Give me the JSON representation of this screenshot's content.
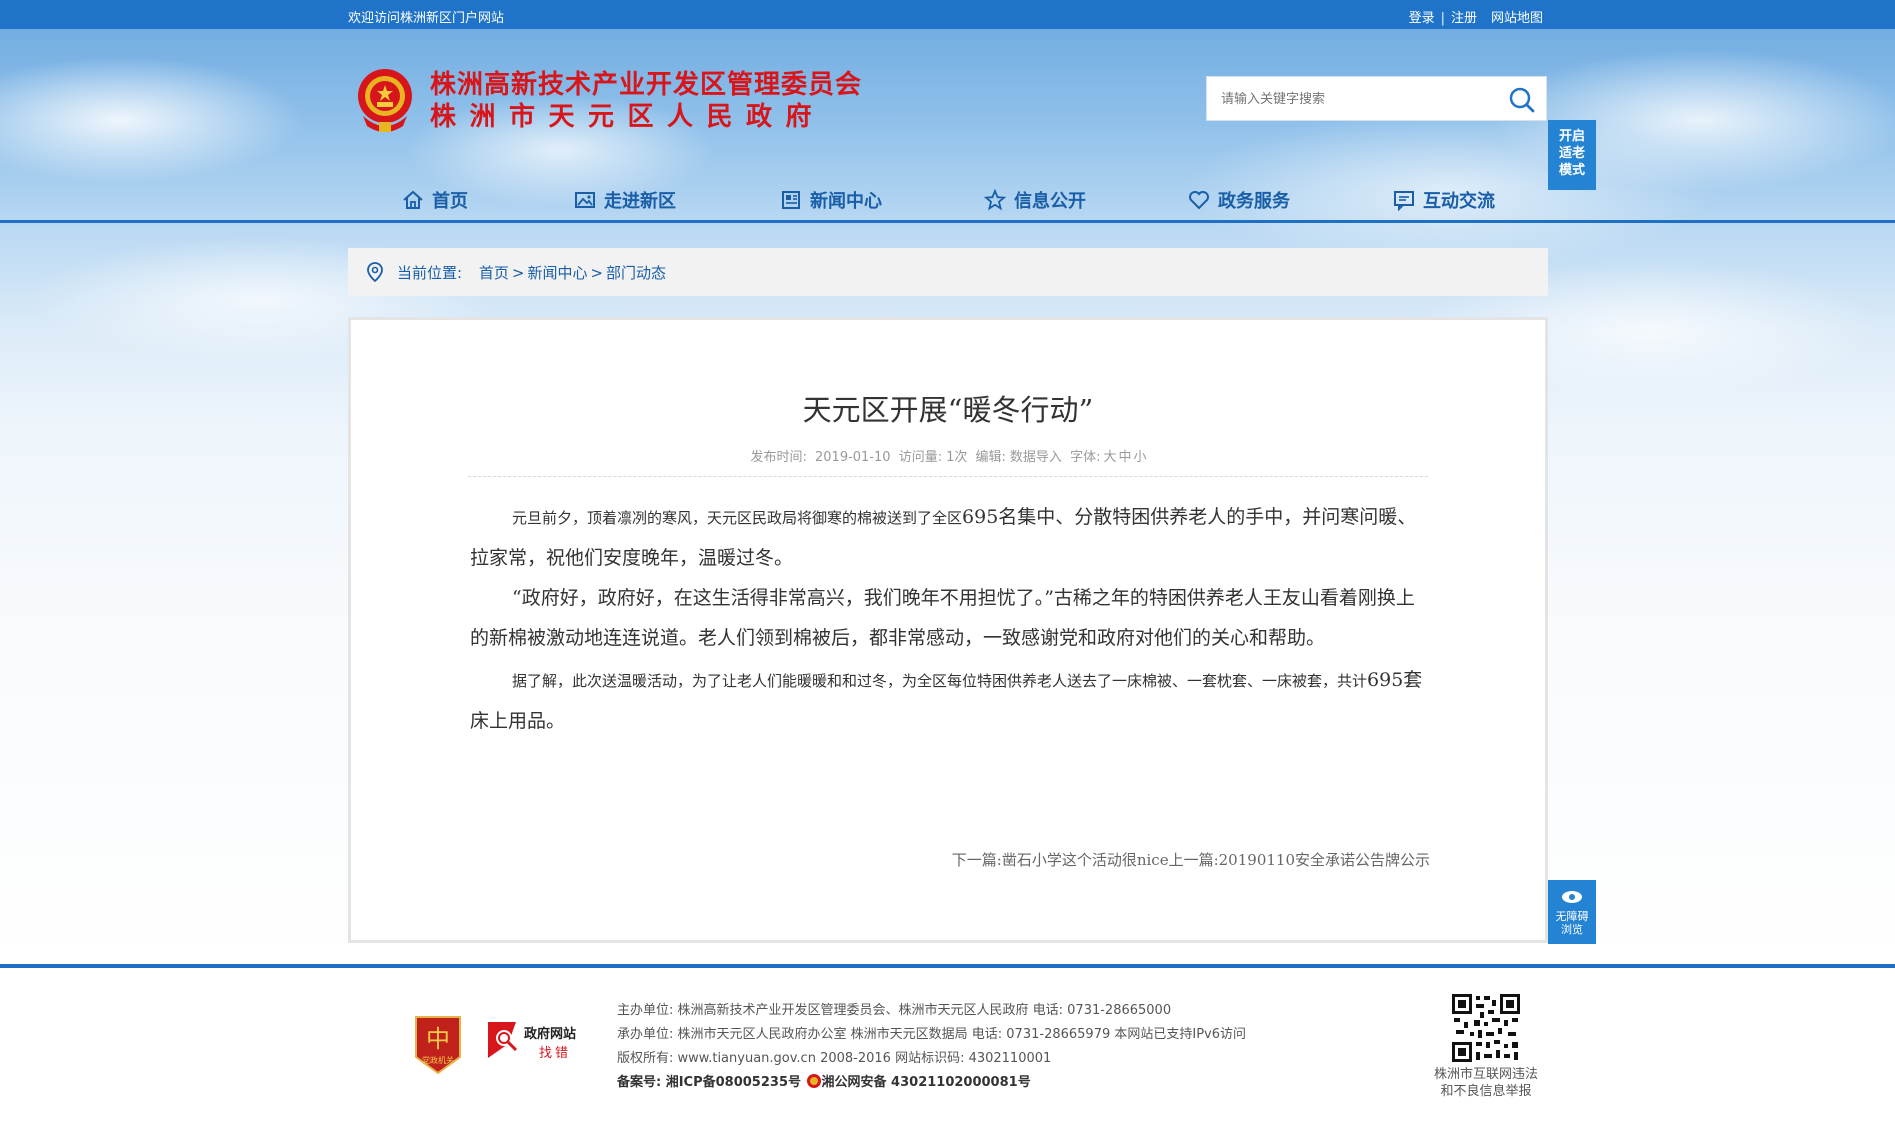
{
  "topbar": {
    "welcome": "欢迎访问株洲新区门户网站",
    "login": "登录",
    "register": "注册",
    "sitemap": "网站地图"
  },
  "header": {
    "title_line1": "株洲高新技术产业开发区管理委员会",
    "title_line2": "株洲市天元区人民政府",
    "search_placeholder": "请输入关键字搜索"
  },
  "side": {
    "elder_mode": [
      "开启",
      "适老",
      "模式"
    ],
    "accessible": [
      "无障碍",
      "浏览"
    ]
  },
  "nav": [
    {
      "label": "首页",
      "icon": "home-icon"
    },
    {
      "label": "走进新区",
      "icon": "picture-icon"
    },
    {
      "label": "新闻中心",
      "icon": "news-icon"
    },
    {
      "label": "信息公开",
      "icon": "star-icon"
    },
    {
      "label": "政务服务",
      "icon": "heart-icon"
    },
    {
      "label": "互动交流",
      "icon": "chat-icon"
    }
  ],
  "breadcrumb": {
    "prefix": "当前位置:",
    "items": [
      "首页",
      "新闻中心",
      "部门动态"
    ]
  },
  "article": {
    "title": "天元区开展“暖冬行动”",
    "meta": {
      "date_label": "发布时间:",
      "date": "2019-01-10",
      "views_label": "访问量:",
      "views": "1次",
      "editor_label": "编辑:",
      "editor": "数据导入",
      "font_label": "字体:",
      "font_large": "大",
      "font_medium": "中",
      "font_small": "小"
    },
    "p1_small": "元旦前夕，顶着凛冽的寒风，天元区民政局将御寒的棉被送到了全区",
    "p1_rest": "695名集中、分散特困供养老人的手中，并问寒问暖、拉家常，祝他们安度晚年，温暖过冬。",
    "p2": "“政府好，政府好，在这生活得非常高兴，我们晚年不用担忧了。”古稀之年的特困供养老人王友山看着刚换上的新棉被激动地连连说道。老人们领到棉被后，都非常感动，一致感谢党和政府对他们的关心和帮助。",
    "p3_small": "据了解，此次送温暖活动，为了让老人们能暖暖和和过冬，为全区每位特困供养老人送去了一床棉被、一套枕套、一床被套，共计",
    "p3_rest": "695套床上用品。",
    "next_label": "下一篇:",
    "next_title": "凿石小学这个活动很nice",
    "prev_label": "上一篇:",
    "prev_title": "20190110安全承诺公告牌公示"
  },
  "footer": {
    "party_badge": "党政机关",
    "error_badge_top": "政府网站",
    "error_badge_bottom": "找错",
    "sponsor": "主办单位: 株洲高新技术产业开发区管理委员会、株洲市天元区人民政府 电话: 0731-28665000",
    "organizer": "承办单位: 株洲市天元区人民政府办公室 株洲市天元区数据局 电话: 0731-28665979 本网站已支持IPv6访问",
    "copyright": "版权所有: www.tianyuan.gov.cn 2008-2016 网站标识码: 4302110001",
    "icp": "备案号: 湘ICP备08005235号",
    "police": "湘公网安备 43021102000081号",
    "report_line1": "株洲市互联网违法",
    "report_line2": "和不良信息举报"
  },
  "colors": {
    "brand_blue": "#1f74c9",
    "nav_text": "#1a5ea8",
    "title_red": "#d7161b"
  }
}
